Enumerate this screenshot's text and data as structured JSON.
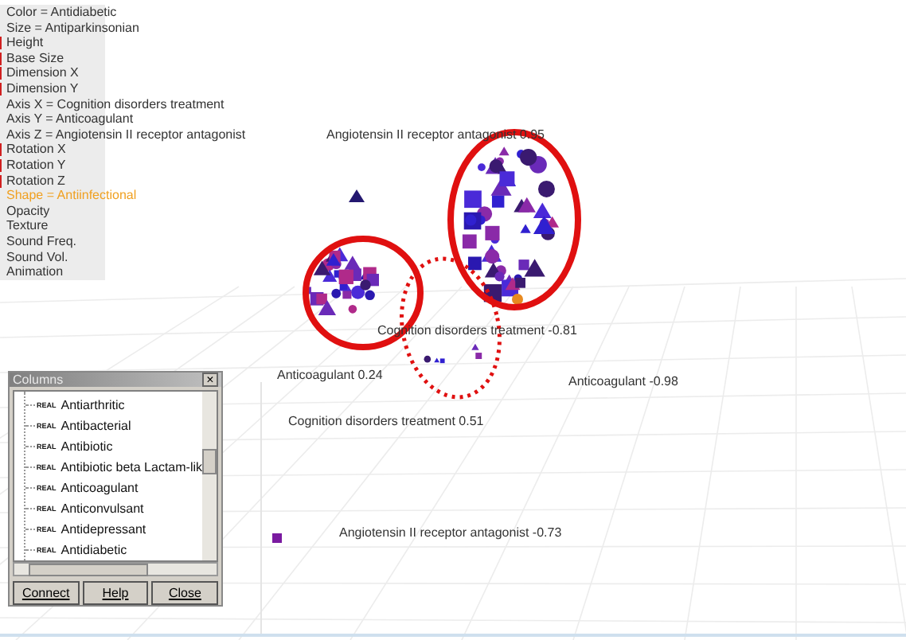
{
  "properties": [
    {
      "label": "Color = Antidiabetic",
      "marked": false,
      "highlighted": false
    },
    {
      "label": "Size = Antiparkinsonian",
      "marked": false,
      "highlighted": false
    },
    {
      "label": "Height",
      "marked": true,
      "highlighted": false
    },
    {
      "label": "Base Size",
      "marked": true,
      "highlighted": false
    },
    {
      "label": "Dimension X",
      "marked": true,
      "highlighted": false
    },
    {
      "label": "Dimension Y",
      "marked": true,
      "highlighted": false
    },
    {
      "label": "Axis X = Cognition disorders treatment",
      "marked": false,
      "highlighted": false
    },
    {
      "label": "Axis Y = Anticoagulant",
      "marked": false,
      "highlighted": false
    },
    {
      "label": "Axis Z = Angiotensin II receptor antagonist",
      "marked": false,
      "highlighted": false
    },
    {
      "label": "Rotation X",
      "marked": true,
      "highlighted": false
    },
    {
      "label": "Rotation Y",
      "marked": true,
      "highlighted": false
    },
    {
      "label": "Rotation Z",
      "marked": true,
      "highlighted": false
    },
    {
      "label": "Shape = Antiinfectional",
      "marked": false,
      "highlighted": true
    },
    {
      "label": "Opacity",
      "marked": false,
      "highlighted": false
    },
    {
      "label": "Texture",
      "marked": false,
      "highlighted": false
    },
    {
      "label": "Sound Freq.",
      "marked": false,
      "highlighted": false
    },
    {
      "label": "Sound Vol.",
      "marked": false,
      "highlighted": false
    },
    {
      "label": "Animation",
      "marked": false,
      "highlighted": false
    }
  ],
  "axis_labels": [
    {
      "text": "Angiotensin II receptor antagonist 0.95"
    },
    {
      "text": "Cognition disorders treatment -0.81"
    },
    {
      "text": "Anticoagulant 0.24"
    },
    {
      "text": "Anticoagulant -0.98"
    },
    {
      "text": "Cognition disorders treatment 0.51"
    },
    {
      "text": "Angiotensin II receptor antagonist -0.73"
    }
  ],
  "columns_window": {
    "title": "Columns",
    "close": "×",
    "items": [
      {
        "type": "REAL",
        "name": "Antiarthritic"
      },
      {
        "type": "REAL",
        "name": "Antibacterial"
      },
      {
        "type": "REAL",
        "name": "Antibiotic"
      },
      {
        "type": "REAL",
        "name": "Antibiotic beta Lactam-lik"
      },
      {
        "type": "REAL",
        "name": "Anticoagulant"
      },
      {
        "type": "REAL",
        "name": "Anticonvulsant"
      },
      {
        "type": "REAL",
        "name": "Antidepressant"
      },
      {
        "type": "REAL",
        "name": "Antidiabetic"
      }
    ],
    "buttons": [
      "Connect",
      "Help",
      "Close"
    ]
  }
}
